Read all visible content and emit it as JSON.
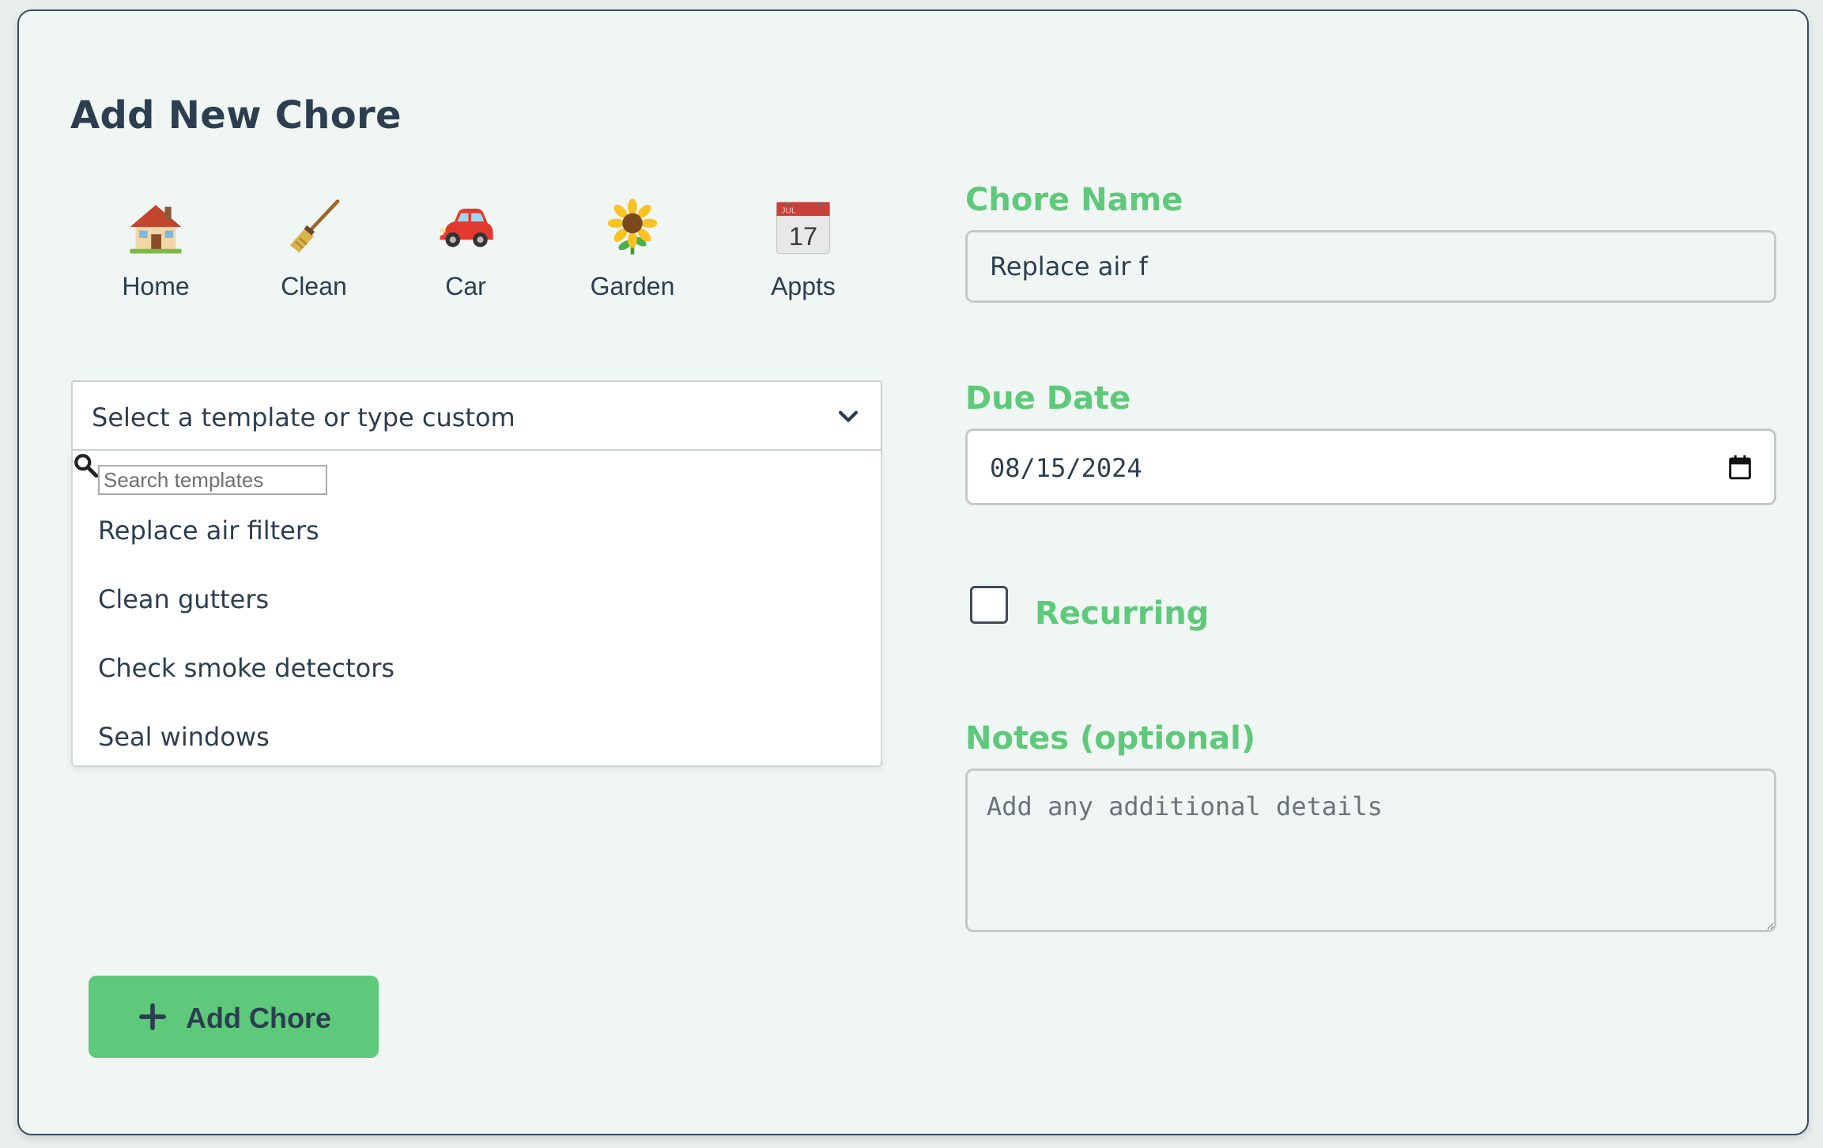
{
  "form": {
    "title": "Add New Chore",
    "categories": [
      {
        "label": "Home",
        "icon": "house-icon"
      },
      {
        "label": "Clean",
        "icon": "broom-icon"
      },
      {
        "label": "Car",
        "icon": "car-icon"
      },
      {
        "label": "Garden",
        "icon": "sunflower-icon"
      },
      {
        "label": "Appts",
        "icon": "calendar-icon",
        "calendar_month": "JUL",
        "calendar_day": "17"
      }
    ],
    "template_select": {
      "selected_text": "Select a template or type custom",
      "search_placeholder": "Search templates",
      "options": [
        "Replace air filters",
        "Clean gutters",
        "Check smoke detectors",
        "Seal windows"
      ]
    },
    "chore_name": {
      "label": "Chore Name",
      "value": "Replace air f"
    },
    "due_date": {
      "label": "Due Date",
      "value": "08/15/2024"
    },
    "recurring": {
      "label": "Recurring",
      "checked": false
    },
    "notes": {
      "label": "Notes (optional)",
      "placeholder": "Add any additional details"
    },
    "submit_label": "Add Chore"
  },
  "colors": {
    "accent": "#5ec97a",
    "text": "#2c3e50",
    "card_background": "#f0f6f3"
  }
}
